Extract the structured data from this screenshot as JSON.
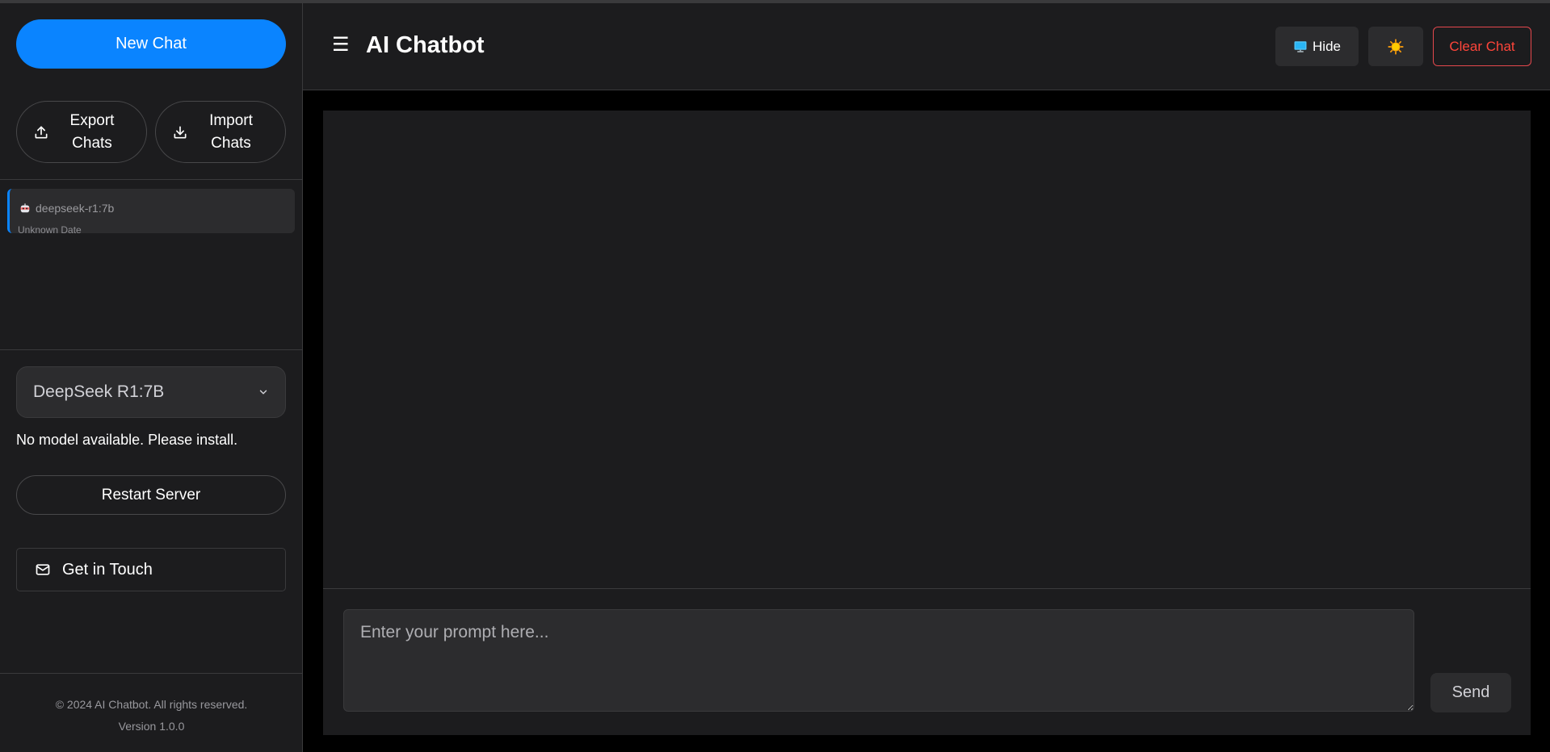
{
  "sidebar": {
    "new_chat_label": "New Chat",
    "export_label": "Export\nChats",
    "import_label": "Import\nChats",
    "chat_list": [
      {
        "title": "deepseek-r1:7b",
        "date": "Unknown Date",
        "icon": "robot-icon"
      }
    ],
    "model_select": {
      "selected": "DeepSeek R1:7B"
    },
    "model_status": "No model available. Please install.",
    "restart_label": "Restart Server",
    "contact_label": "Get in Touch",
    "footer": {
      "copyright": "© 2024 AI Chatbot. All rights reserved.",
      "version": "Version 1.0.0"
    }
  },
  "header": {
    "menu_glyph": "☰",
    "title": "AI Chatbot",
    "hide_label": "Hide",
    "clear_label": "Clear Chat"
  },
  "composer": {
    "placeholder": "Enter your prompt here...",
    "value": "",
    "send_label": "Send"
  },
  "colors": {
    "accent": "#0a84ff",
    "danger": "#ff453a",
    "background": "#1c1c1e"
  },
  "icons": {
    "export": "upload-icon",
    "import": "download-icon",
    "contact": "mail-icon",
    "hide": "monitor-icon",
    "theme": "sun-icon",
    "select": "chevron-down-icon"
  }
}
